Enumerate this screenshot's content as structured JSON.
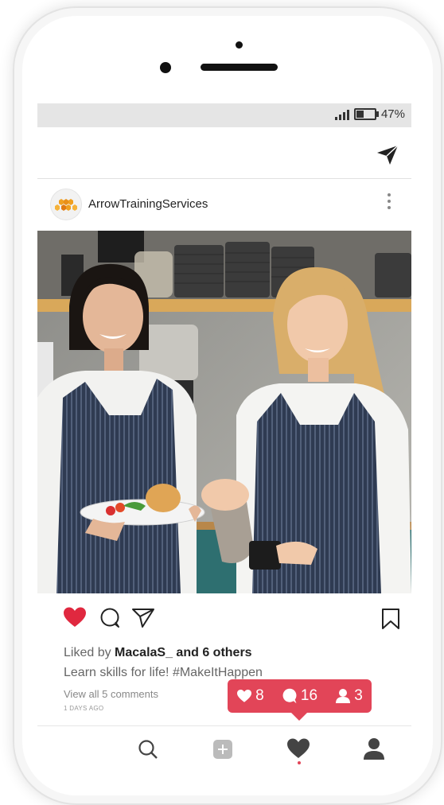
{
  "status_bar": {
    "battery": "47%"
  },
  "post": {
    "username": "ArrowTrainingServices",
    "liked_by_prefix": "Liked by ",
    "liked_by_user": "MacalaS_",
    "liked_by_suffix": " and 6 others",
    "caption": "Learn skills for life! #MakeItHappen",
    "view_all": "View all 5 comments",
    "time_ago": "1 DAYS AGO"
  },
  "notifications": {
    "likes": "8",
    "comments": "16",
    "follows": "3"
  },
  "icons": {
    "direct": "paper-plane-icon",
    "more": "vertical-dots-icon",
    "like": "heart-icon",
    "comment": "comment-icon",
    "share": "send-icon",
    "save": "bookmark-icon"
  },
  "colors": {
    "accent": "#e24558",
    "heart": "#e0283f"
  }
}
